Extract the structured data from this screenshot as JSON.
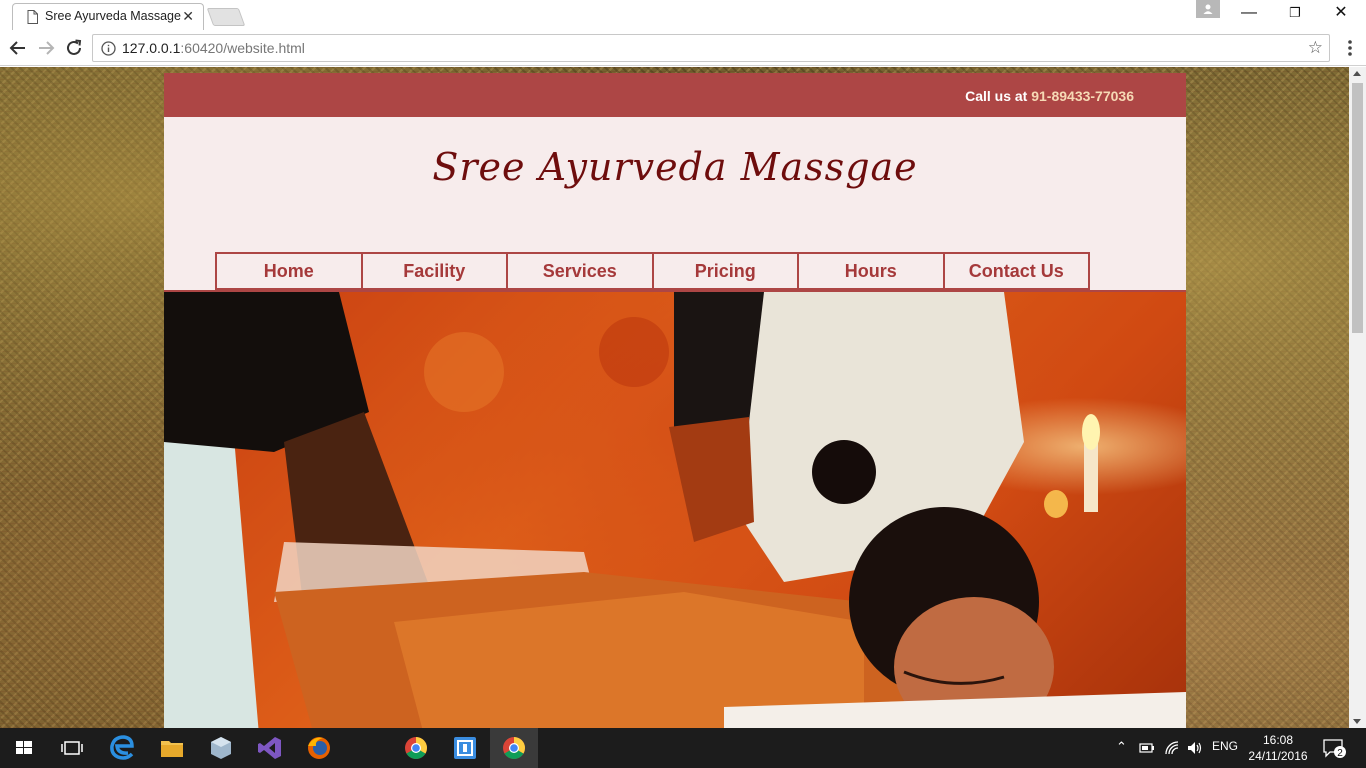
{
  "browser": {
    "tab_title": "Sree Ayurveda Massage",
    "url_host": "127.0.0.1",
    "url_rest": ":60420/website.html",
    "window_controls": {
      "minimize": "—",
      "maximize": "❐",
      "close": "✕"
    }
  },
  "page": {
    "call_label": "Call us at ",
    "phone": "91-89433-77036",
    "title": "Sree Ayurveda Massgae",
    "nav": [
      {
        "label": "Home"
      },
      {
        "label": "Facility"
      },
      {
        "label": "Services"
      },
      {
        "label": "Pricing"
      },
      {
        "label": "Hours"
      },
      {
        "label": "Contact Us"
      }
    ],
    "colors": {
      "header_bar": "#ad4645",
      "title": "#6e0d0d",
      "nav_text": "#a5393a",
      "panel": "#f7ecec"
    }
  },
  "taskbar": {
    "language": "ENG",
    "time": "16:08",
    "date": "24/11/2016",
    "notifications": "2",
    "icons": [
      "windows-start-icon",
      "task-view-icon",
      "edge-icon",
      "file-explorer-icon",
      "sandbox-icon",
      "visual-studio-icon",
      "firefox-icon",
      "chrome-icon",
      "app-icon",
      "chrome-icon-active"
    ]
  }
}
